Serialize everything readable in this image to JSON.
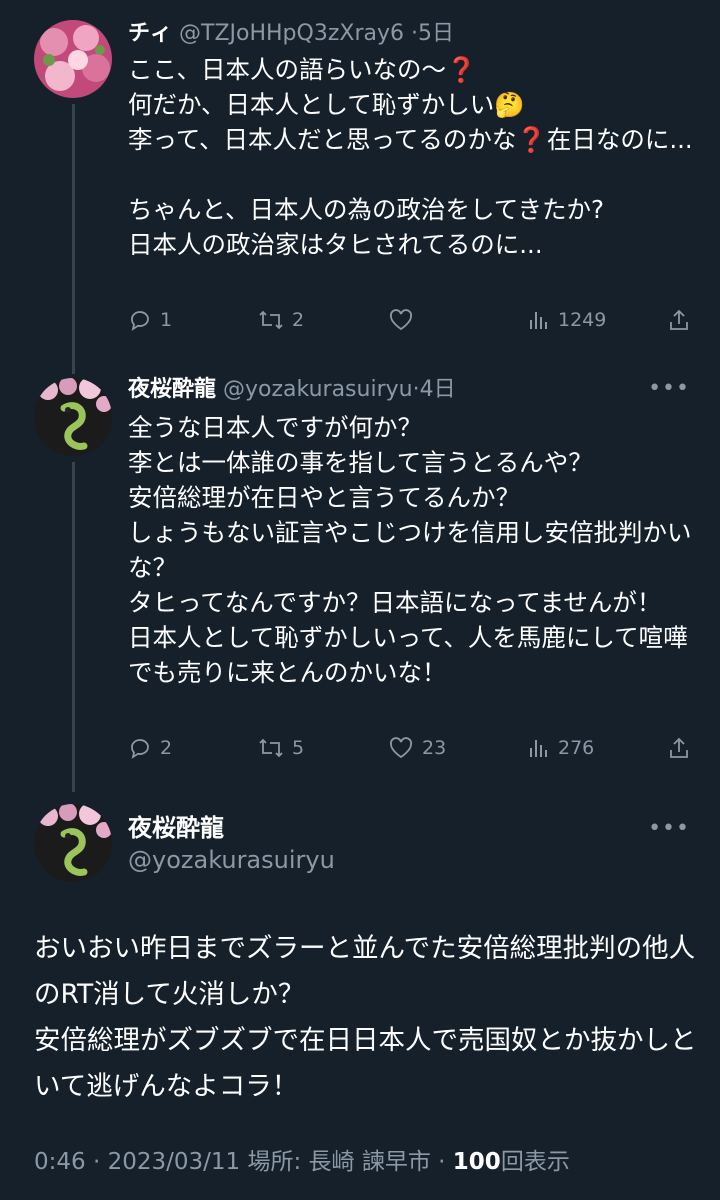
{
  "tweets": [
    {
      "name": "チィ",
      "handle": "@TZJoHHpQ3zXray6",
      "time": "5日",
      "body": "ここ、日本人の語らいなの〜❓\n何だか、日本人として恥ずかしい🤔\n李って、日本人だと思ってるのかな❓在日なのに...\n\nちゃんと、日本人の為の政治をしてきたか?\n日本人の政治家はタヒされてるのに...",
      "replies": "1",
      "retweets": "2",
      "likes": "",
      "views": "1249"
    },
    {
      "name": "夜桜酔龍",
      "handle": "@yozakurasuiryu",
      "time": "4日",
      "body": "全うな日本人ですが何か？\n李とは一体誰の事を指して言うとるんや？\n安倍総理が在日やと言うてるんか？\nしょうもない証言やこじつけを信用し安倍批判かいな？\nタヒってなんですか？日本語になってませんが！\n日本人として恥ずかしいって、人を馬鹿にして喧嘩でも売りに来とんのかいな！",
      "replies": "2",
      "retweets": "5",
      "likes": "23",
      "views": "276"
    }
  ],
  "focus": {
    "name": "夜桜酔龍",
    "handle": "@yozakurasuiryu",
    "body": "おいおい昨日までズラーと並んでた安倍総理批判の他人のRT消して火消しか？\n安倍総理がズブズブで在日日本人で売国奴とか抜かしといて逃げんなよコラ！",
    "time": "0:46",
    "date": "2023/03/11",
    "location": "場所: 長崎 諫早市",
    "views_count": "100",
    "views_label": "回表示",
    "separator": "·"
  },
  "icons": [
    "reply-icon",
    "retweet-icon",
    "like-icon",
    "views-icon",
    "share-icon",
    "more-icon"
  ],
  "colors": {
    "background": "#15202b",
    "secondary_text": "#8b98a5",
    "thread_line": "#38444d"
  }
}
